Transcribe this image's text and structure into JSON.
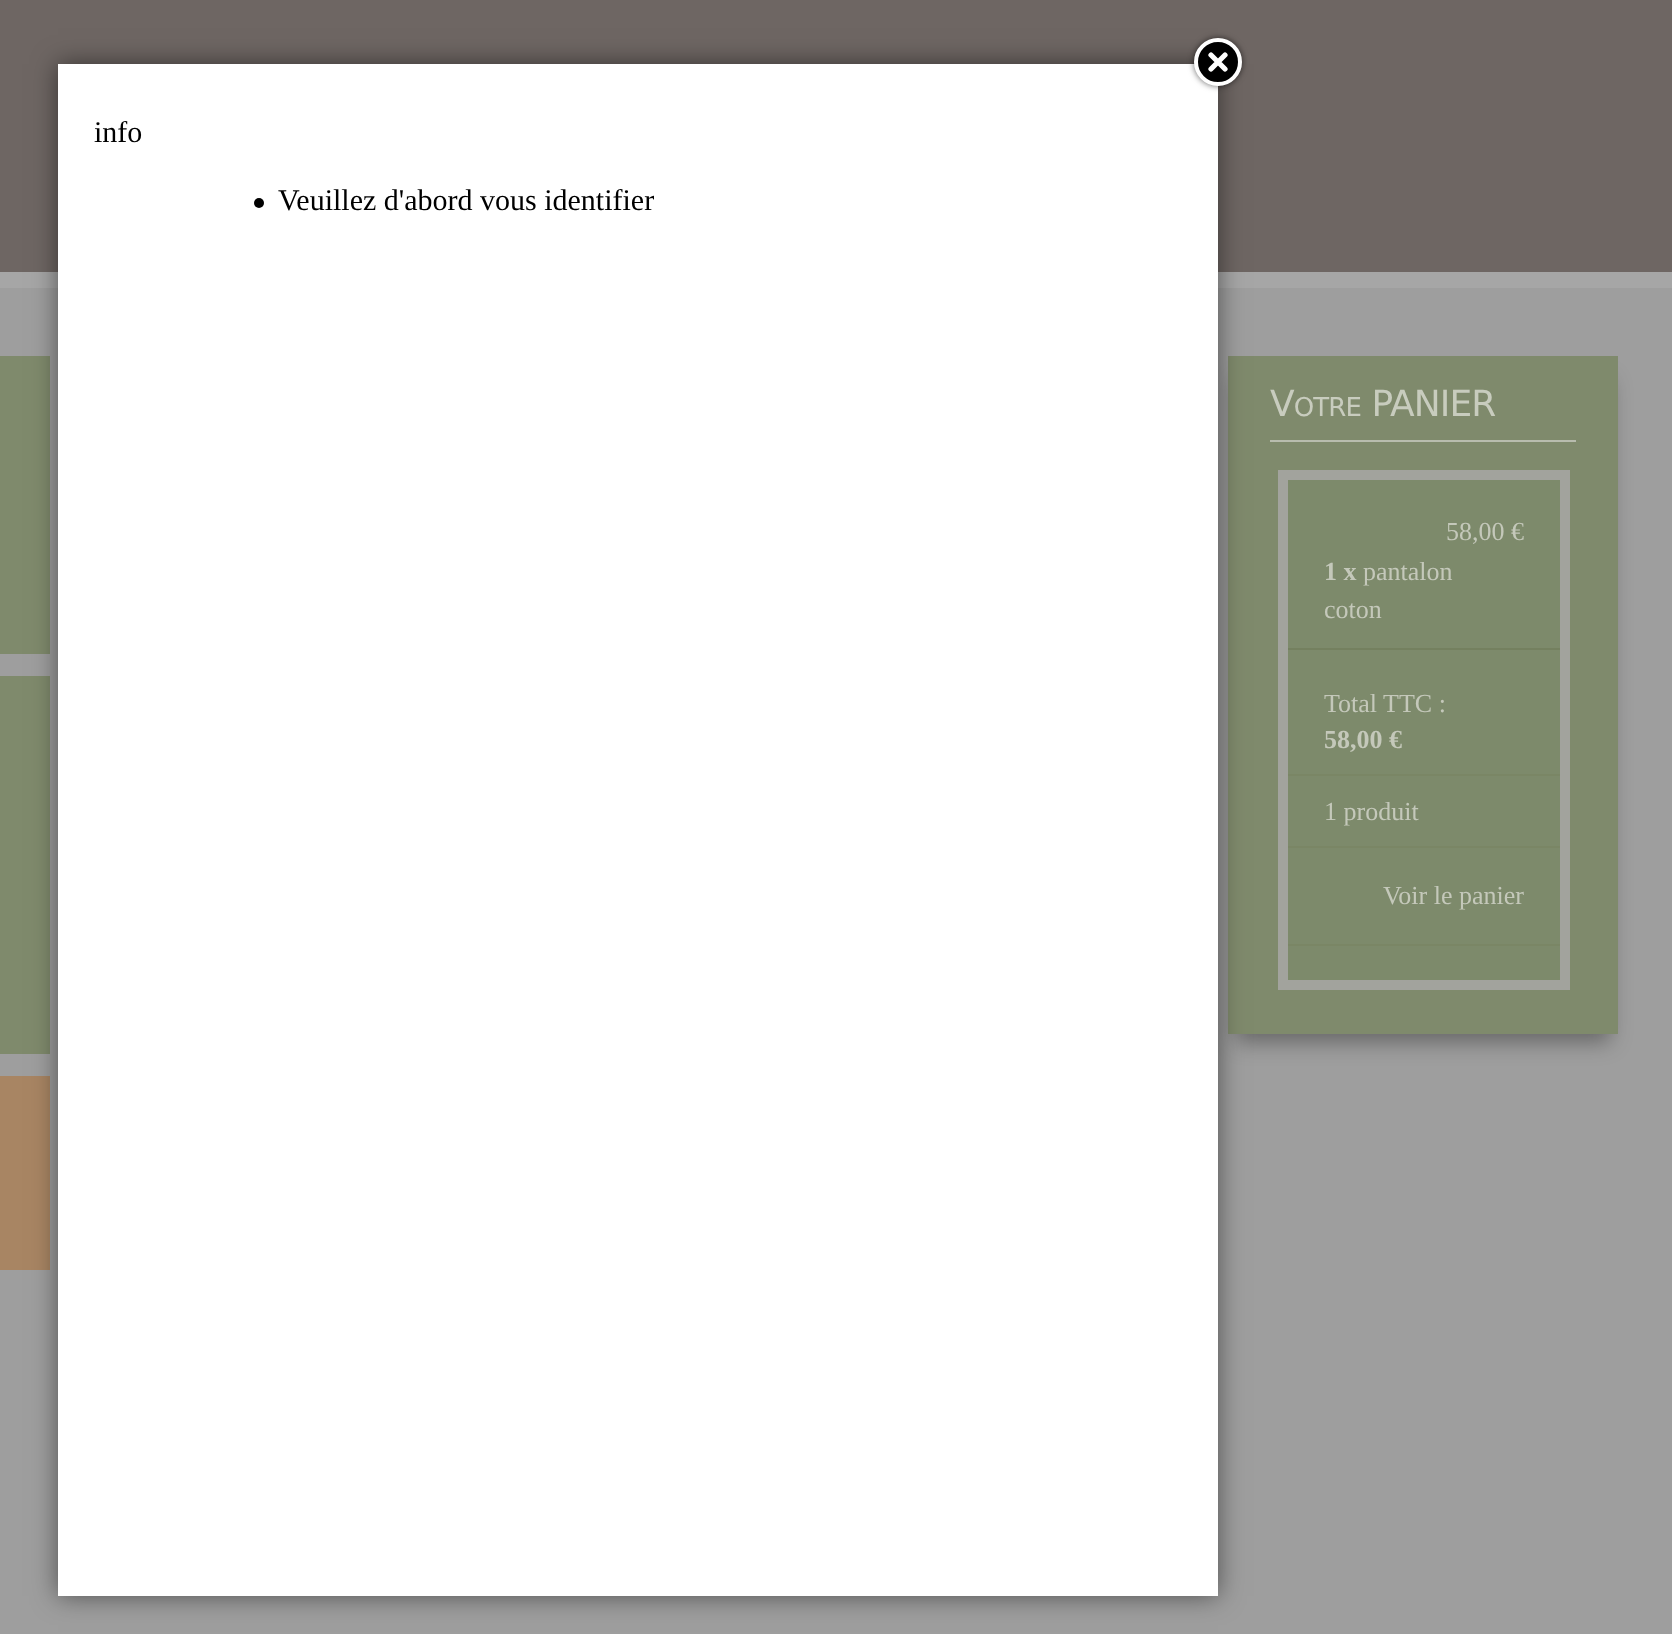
{
  "modal": {
    "title": "info",
    "messages": [
      "Veuillez d'abord vous identifier"
    ]
  },
  "cart": {
    "title": "Votre PANIER",
    "items": [
      {
        "price": "58,00 €",
        "quantity": "1 x",
        "name": "pantalon coton"
      }
    ],
    "total_label": "Total TTC :",
    "total_value": "58,00 €",
    "count": "1 produit",
    "link": "Voir le panier"
  }
}
